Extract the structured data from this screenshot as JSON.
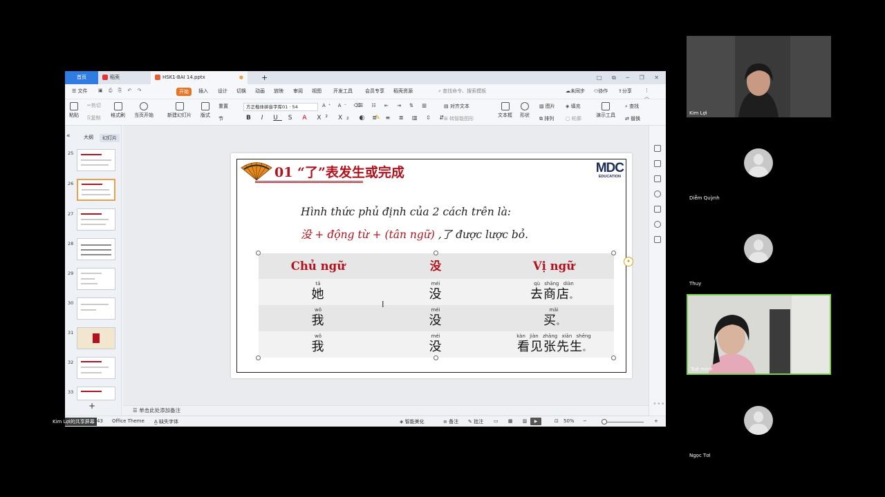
{
  "window": {
    "tabs": {
      "home": "首页",
      "daoke": "稻壳",
      "file": "HSK1-BAI 14.pptx"
    },
    "controls": "□ ⧉ ─ ❐ ✕"
  },
  "menubar": {
    "file": "☰ 文件",
    "items": [
      "开始",
      "插入",
      "设计",
      "切换",
      "动画",
      "放映",
      "审阅",
      "视图",
      "开发工具",
      "会员专享",
      "稻壳资源"
    ],
    "search": "查找命令、搜索模板",
    "sync": "未同步",
    "collab": "协作",
    "share": "分享"
  },
  "ribbon": {
    "paste": "粘贴",
    "cut": "剪切",
    "copy": "复制",
    "format_painter": "格式刷",
    "play_current": "当页开始",
    "new_slide": "新建幻灯片",
    "layout": "版式",
    "section": "节",
    "reset": "重置",
    "font_name": "方正楷体拼音字库01",
    "font_size": "54",
    "align_text": "对齐文本",
    "smartart": "转智能图形",
    "textbox": "文本框",
    "shape": "形状",
    "picture": "图片",
    "arrange": "排列",
    "fill": "填充",
    "outline": "轮廓",
    "present_tools": "演示工具",
    "find": "查找",
    "replace": "替换"
  },
  "leftpanel": {
    "outline": "大纲",
    "slides": "幻灯片",
    "thumbs": [
      "25",
      "26",
      "27",
      "28",
      "29",
      "30",
      "31",
      "32",
      "33"
    ],
    "add": "+"
  },
  "slide": {
    "title": "01 “了”表发生或完成",
    "logo_big": "MDC",
    "logo_small": "EDUCATION",
    "line1": "Hình thức phủ định của 2 cách trên là:",
    "line2_red": "没 + động từ + (tân ngữ)",
    "line2_rest": " ,了 được lược bỏ.",
    "table": {
      "headers": [
        "Chủ ngữ",
        "没",
        "Vị ngữ"
      ],
      "rows": [
        {
          "py1": "tā",
          "hz1": "她",
          "py2": "méi",
          "hz2": "没",
          "py3": "qù shāng diàn",
          "hz3": "去商店"
        },
        {
          "py1": "wǒ",
          "hz1": "我",
          "py2": "méi",
          "hz2": "没",
          "py3": "mǎi",
          "hz3": "买"
        },
        {
          "py1": "wǒ",
          "hz1": "我",
          "py2": "méi",
          "hz2": "没",
          "py3": "kàn jiàn zhāng xiān shēng",
          "hz3": "看见张先生"
        }
      ],
      "period": "。"
    }
  },
  "notes": "单击此处添加备注",
  "statusbar": {
    "slide_num": "43",
    "theme": "Office Theme",
    "missing_font": "缺失字体",
    "smart_beautify": "智能美化",
    "notes": "备注",
    "comments": "批注",
    "zoom": "50%"
  },
  "share_label": "Kim Lợi的共享屏幕",
  "participants": [
    {
      "name": "Kim Lợi"
    },
    {
      "name": "Diễm Quỳnh"
    },
    {
      "name": "Thuy"
    },
    {
      "name": "Tuệ minh"
    },
    {
      "name": "Ngọc Tơi"
    }
  ],
  "colors": {
    "accent_red": "#b0131e",
    "wps_blue": "#2f7de1",
    "start_orange": "#e87322",
    "active_speaker": "#7bd04c"
  }
}
